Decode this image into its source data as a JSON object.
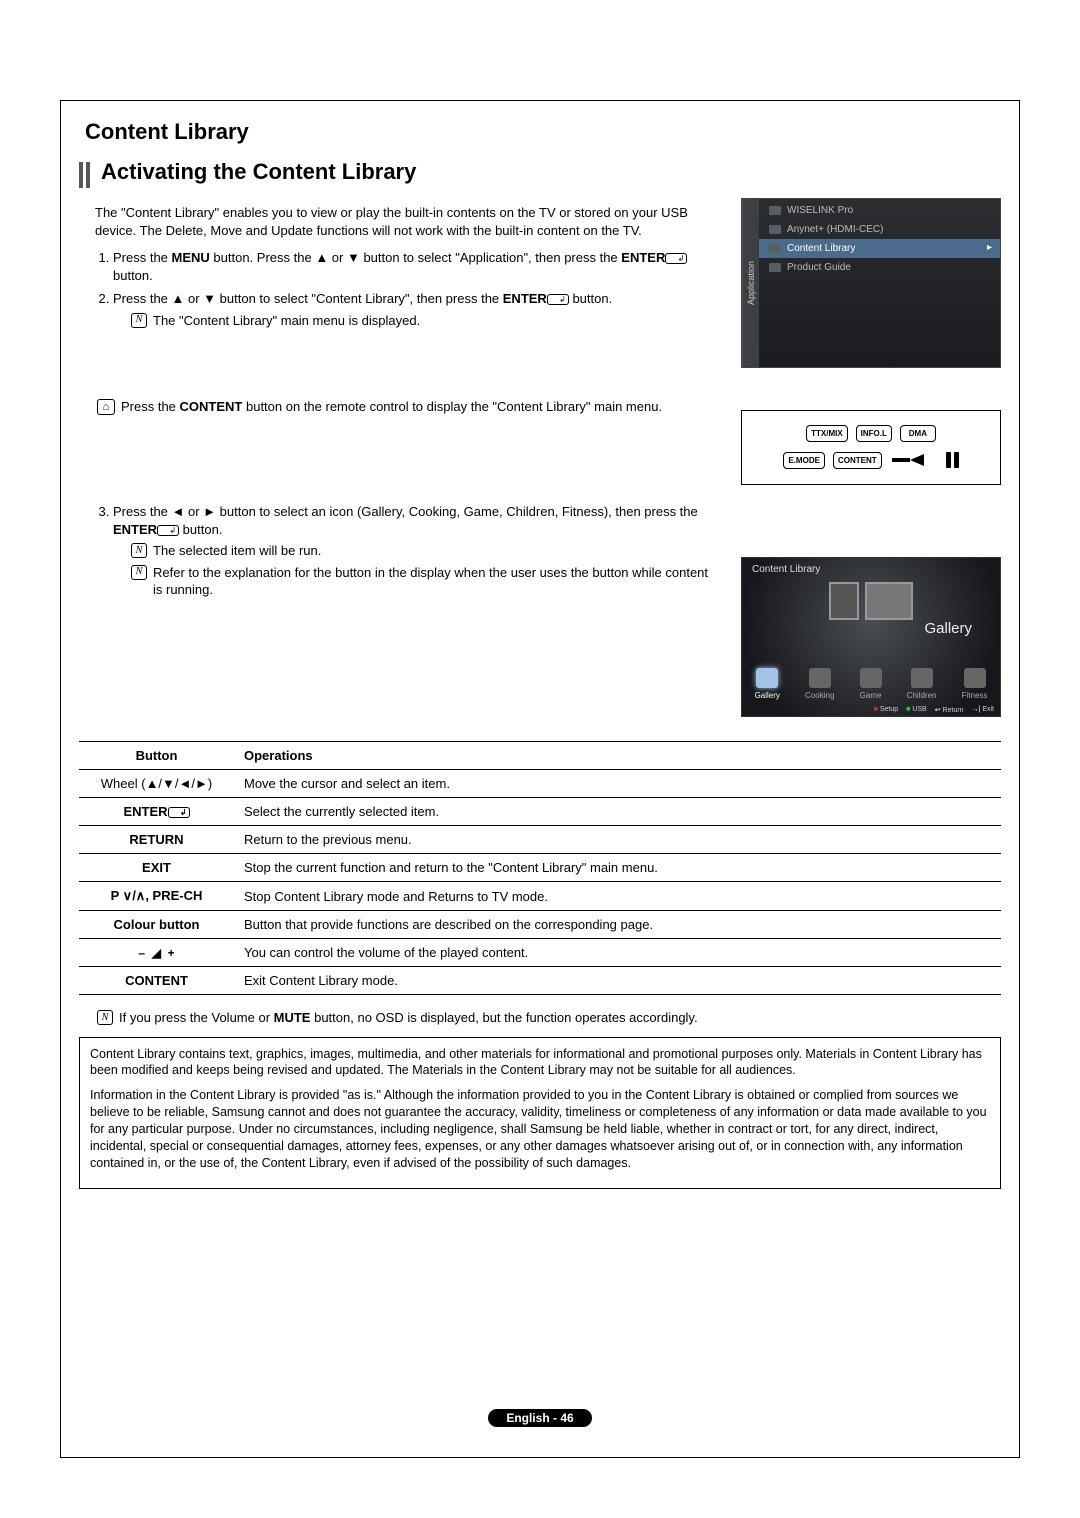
{
  "section_title": "Content Library",
  "subsection_title": "Activating the Content Library",
  "intro": "The \"Content Library\" enables you to view or play the built-in contents on the TV or stored on your USB device. The Delete, Move and Update functions will not work with the built-in content on the TV.",
  "steps": {
    "s1a": "Press the ",
    "s1b": "MENU",
    "s1c": " button. Press the ▲ or ▼ button to select \"Application\", then press the ",
    "s1d": "ENTER",
    "s1e": " button.",
    "s2a": "Press the ▲ or ▼ button to select \"Content Library\", then press the ",
    "s2b": "ENTER",
    "s2c": " button.",
    "s2n": "The \"Content Library\" main menu is displayed.",
    "rc_a": "Press the ",
    "rc_b": "CONTENT",
    "rc_c": " button on the remote control to display the \"Content Library\" main menu.",
    "s3a": "Press the ◄ or ► button to select an icon (Gallery, Cooking, Game, Children, Fitness), then press the ",
    "s3b": "ENTER",
    "s3c": " button.",
    "s3n1": "The selected item will be run.",
    "s3n2": "Refer to the explanation for the button in the display when the user uses the button while content is running."
  },
  "osd": {
    "tab": "Application",
    "items": [
      "WISELINK Pro",
      "Anynet+ (HDMI-CEC)",
      "Content Library",
      "Product Guide"
    ]
  },
  "remote": {
    "r1": [
      "TTX/MIX",
      "INFO.L",
      "DMA"
    ],
    "r2": [
      "E.MODE",
      "CONTENT"
    ]
  },
  "gallery": {
    "title": "Content Library",
    "selected": "Gallery",
    "icons": [
      "Gallery",
      "Cooking",
      "Game",
      "Children",
      "Fitness"
    ],
    "footer": [
      "Setup",
      "USB",
      "Return",
      "Exit"
    ]
  },
  "table": {
    "h1": "Button",
    "h2": "Operations",
    "rows": [
      {
        "k": "Wheel (▲/▼/◄/►)",
        "bold": false,
        "v": "Move the cursor and select an item."
      },
      {
        "k": "ENTER",
        "enter": true,
        "bold": true,
        "v": "Select the currently selected item."
      },
      {
        "k": "RETURN",
        "bold": true,
        "v": "Return to the previous menu."
      },
      {
        "k": "EXIT",
        "bold": true,
        "v": "Stop the current function and return to the \"Content Library\" main menu."
      },
      {
        "k": "P ∨/∧, PRE-CH",
        "bold": true,
        "v": "Stop Content Library mode and Returns to TV mode."
      },
      {
        "k": "Colour button",
        "bold": true,
        "v": "Button that provide functions are described on the corresponding page."
      },
      {
        "k": "vol",
        "bold": true,
        "v": "You can control the volume of the played content."
      },
      {
        "k": "CONTENT",
        "bold": true,
        "v": "Exit Content Library mode."
      }
    ]
  },
  "bottom_note_a": "If you press the Volume or ",
  "bottom_note_b": "MUTE",
  "bottom_note_c": " button, no OSD is displayed, but the function operates accordingly.",
  "disclaimer": {
    "p1": "Content Library contains text, graphics, images, multimedia, and other materials for informational and promotional purposes only. Materials in Content Library has been modified and keeps being revised and updated.  The Materials in the Content Library may not be suitable for all audiences.",
    "p2": "Information in the Content Library is provided \"as is.\" Although the information provided to you in the Content Library is obtained or complied from sources we believe to be reliable, Samsung cannot and does not guarantee the accuracy, validity, timeliness or completeness of any information or data made available to you for any particular purpose. Under no circumstances, including negligence, shall Samsung be held liable, whether in contract or tort, for any direct, indirect, incidental, special or consequential damages, attorney fees, expenses, or any other damages whatsoever arising out of, or in connection with, any information contained in, or the use of, the Content Library, even if advised of the possibility of such damages."
  },
  "footer": "English - 46"
}
